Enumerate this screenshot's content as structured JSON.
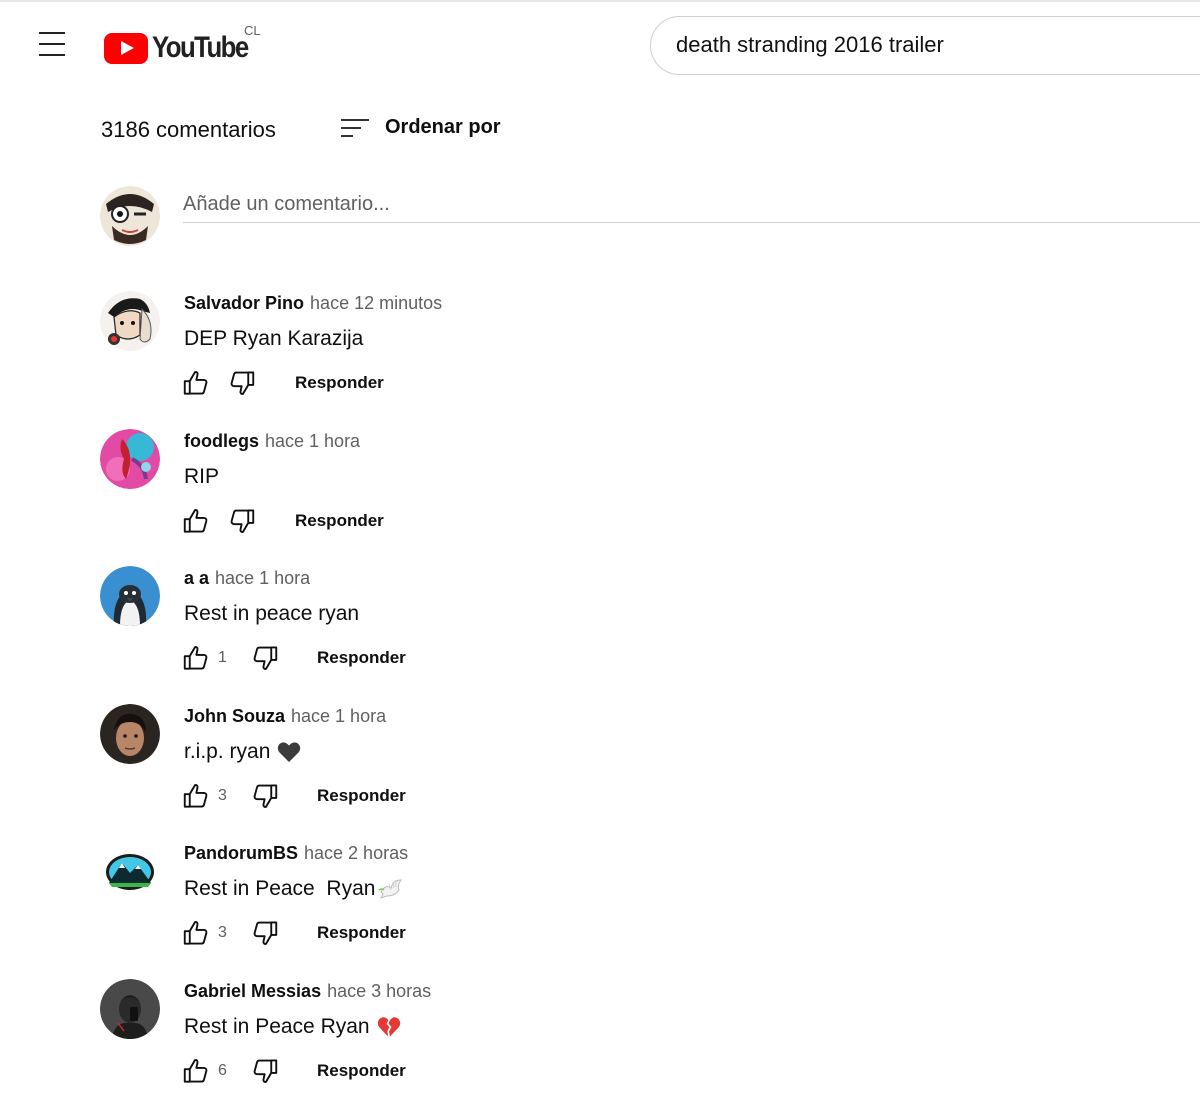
{
  "header": {
    "logo_text": "YouTube",
    "country": "CL",
    "search_value": "death stranding 2016 trailer",
    "accent": "#ff0000"
  },
  "comments_section": {
    "count_label": "3186 comentarios",
    "sort_label": "Ordenar por",
    "add_placeholder": "Añade un comentario..."
  },
  "comments": [
    {
      "author": "Salvador Pino",
      "time": "hace 12 minutos",
      "text": "DEP Ryan Karazija",
      "likes": "",
      "reply": "Responder"
    },
    {
      "author": "foodlegs",
      "time": "hace 1 hora",
      "text": "RIP",
      "likes": "",
      "reply": "Responder"
    },
    {
      "author": "a a",
      "time": "hace 1 hora",
      "text": "Rest in peace ryan",
      "likes": "1",
      "reply": "Responder"
    },
    {
      "author": "John Souza",
      "time": "hace 1 hora",
      "text": "r.i.p. ryan",
      "emoji": "black-heart",
      "likes": "3",
      "reply": "Responder"
    },
    {
      "author": "PandorumBS",
      "time": "hace 2 horas",
      "text": "Rest in Peace  Ryan",
      "emoji": "dove",
      "likes": "3",
      "reply": "Responder"
    },
    {
      "author": "Gabriel Messias",
      "time": "hace 3 horas",
      "text": "Rest in Peace Ryan",
      "emoji": "broken-heart",
      "likes": "6",
      "reply": "Responder"
    }
  ]
}
